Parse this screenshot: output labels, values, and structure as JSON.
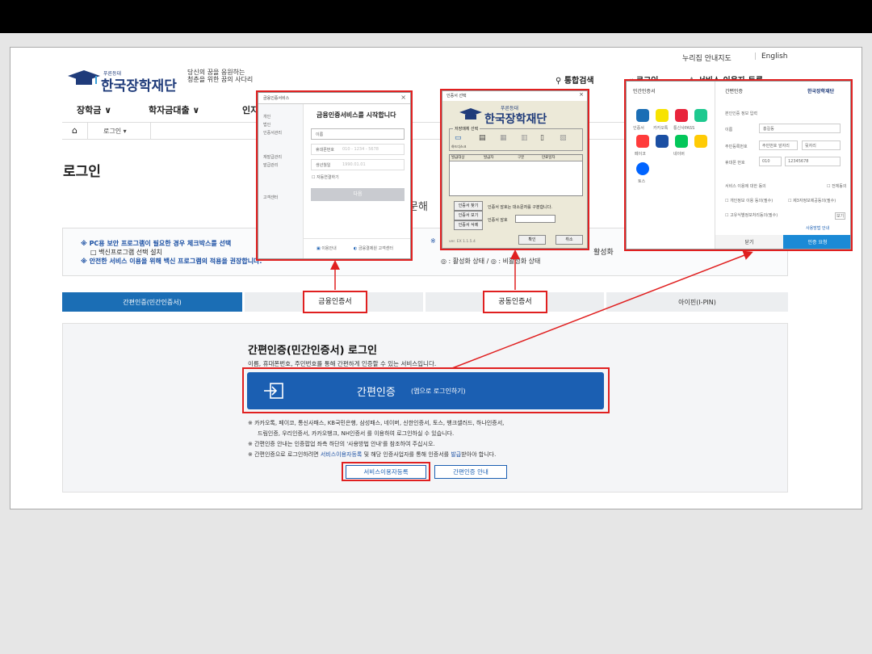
{
  "header": {
    "utility_links": [
      "누리집 안내지도",
      "English"
    ],
    "logo_tagline": "푸른등대",
    "logo_name": "한국장학재단",
    "slogan_line1": "당신의 꿈을 응원하는",
    "slogan_line2": "청춘을 위한 꿈의 사다리",
    "links": {
      "search": "통합검색",
      "login": "로그인",
      "register": "서비스 이용자 등록"
    },
    "gnb": [
      "장학금 ∨",
      "학자금대출 ∨",
      "인지"
    ]
  },
  "breadcrumb": {
    "current": "로그인 ▾"
  },
  "page": {
    "title": "로그인",
    "partial_heading": "문해"
  },
  "notice": {
    "line1": "※ PC용 보안 프로그램이 필요한 경우 체크박스를 선택",
    "line2": "□ 백신프로그램 선택 설치",
    "line3": "※ 안전한 서비스 이용을 위해 백신 프로그램의 적용을 권장합니다.",
    "right1": "활성화",
    "right_status": "◎ : 활성화 상태 / ◎ : 비활성화 상태"
  },
  "tabs": [
    "간편인증(민간인증서)",
    "금융인증서",
    "공동인증서",
    "아이핀(I-PIN)"
  ],
  "panel": {
    "title": "간편인증(민간인증서) 로그인",
    "desc": "이름, 휴대폰번호, 주민번호를 통해 간편하게 인증할 수 있는 서비스입니다.",
    "main_button": "간편인증",
    "main_button_sub": "(앱으로 로그인하기)",
    "note1": "※ 카카오톡, 페이코, 통신사패스, KB국민은행, 삼성패스, 네이버, 신한인증서, 토스, 뱅크샐러드, 하나인증서,",
    "note2": "드림인증, 우리인증서, 카카오뱅크, NH인증서 를 이용하여 로그인하실 수 있습니다.",
    "note3": "※ 간편인증 안내는 인증팝업 좌측 하단의 '사용방법 안내'를 참조하여 주십시오.",
    "note4_pre": "※ 간편인증으로 로그인하려면 ",
    "note4_link": "서비스이용자등록",
    "note4_mid": " 및 해당 인증사업자를 통해 인증서를 ",
    "note4_link2": "발급",
    "note4_post": "받아야 합니다.",
    "btn_register": "서비스이용자등록",
    "btn_guide": "간편인증 안내"
  },
  "callouts": [
    "금융인증서",
    "공동인증서"
  ],
  "popup_finance": {
    "title": "금융인증서비스",
    "heading": "금융인증서비스를 시작합니다",
    "side": [
      "개인",
      "법인",
      "인증서관리",
      "재발급관리",
      "발급관리",
      "고객센터"
    ],
    "fields": [
      "이름",
      "휴대폰번호",
      "생년월일"
    ],
    "placeholders": [
      "",
      "010 - 1234 - 5678",
      "1990.01.01"
    ],
    "auto": "자동연결하기",
    "next": "다음",
    "foot_left": "이용안내",
    "foot_right": "금융결제원 고객센터"
  },
  "popup_joint": {
    "title": "인증서 선택",
    "logo_tag": "푸른등대",
    "logo_name": "한국장학재단",
    "store_label": "저장매체 선택",
    "media": [
      "하드디스크",
      "이동식디스크",
      "보안토큰",
      "저장토큰",
      "휴대폰",
      "인증서"
    ],
    "cols": [
      "발급대상",
      "발급자",
      "구분",
      "만료일자"
    ],
    "buttons": [
      "인증서 찾기",
      "인증서 보기",
      "인증서 삭제"
    ],
    "hint": "인증서 암호는 대소문자를 구분합니다.",
    "pw_label": "인증서 암호",
    "ok": "확인",
    "cancel": "취소",
    "version": "ver. EX 1.1.5.4"
  },
  "popup_simple": {
    "left_title": "민간인증서",
    "right_title": "간편인증",
    "providers": [
      "인증서",
      "카카오톡",
      "통신사PASS",
      "뱅크샐러드",
      "페이코",
      "삼성패스",
      "네이버",
      "KB국민",
      "토스"
    ],
    "section": "본인인증 정보 입력",
    "fields": [
      "이름",
      "주민등록번호",
      "휴대폰 번호"
    ],
    "values": [
      "홍길동",
      "주민번호 앞자리",
      "뒷자리",
      "010",
      "12345678"
    ],
    "agree_title": "서비스 이용에 대한 동의",
    "agree_all": "전체동의",
    "agree_items": [
      "개인정보 이용 동의(필수)",
      "제3자정보제공동의(필수)",
      "고유식별정보처리동의(필수)"
    ],
    "view": "보기",
    "guide": "사용방법 안내",
    "close": "닫기",
    "request": "인증 요청"
  },
  "colors": {
    "brand_blue": "#1b5fb2",
    "tab_blue": "#1b6eb5",
    "highlight_red": "#e02020",
    "header_black": "#000000"
  }
}
